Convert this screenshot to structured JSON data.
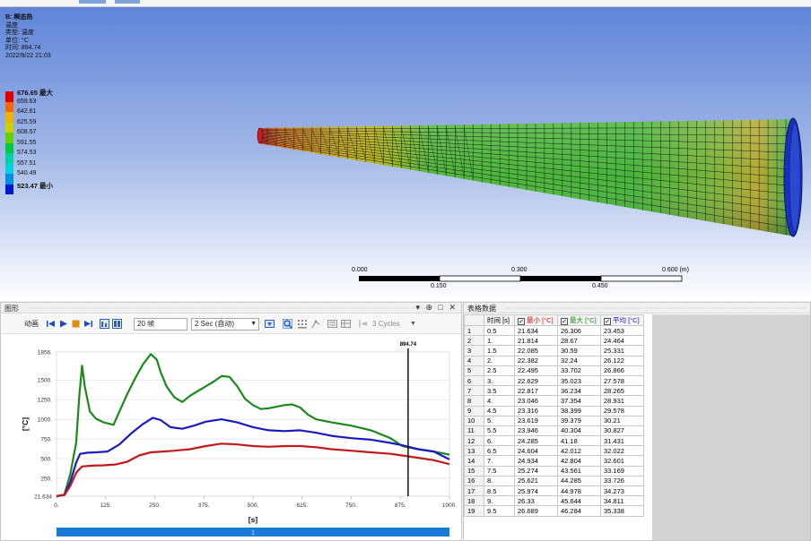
{
  "viewport": {
    "title": "B: 瞬态热",
    "line2": "温度",
    "line3": "类型: 温度",
    "line4": "单位: °C",
    "line5": "时间: 894.74",
    "line6": "2022/9/22 21:03",
    "legend": [
      {
        "label": "676.65 最大",
        "color": "#e00000",
        "bold": true
      },
      {
        "label": "659.63",
        "color": "#f06a00"
      },
      {
        "label": "642.61",
        "color": "#f0b400"
      },
      {
        "label": "625.59",
        "color": "#c8d200"
      },
      {
        "label": "608.57",
        "color": "#62d200"
      },
      {
        "label": "591.55",
        "color": "#00c840"
      },
      {
        "label": "574.53",
        "color": "#00d2a0"
      },
      {
        "label": "557.51",
        "color": "#00d2dc"
      },
      {
        "label": "540.49",
        "color": "#0090e0"
      },
      {
        "label": "523.47 最小",
        "color": "#0018d0",
        "bold": true
      }
    ],
    "scale": {
      "l0": "0.000",
      "l1": "0.150",
      "l2": "0.300",
      "l3": "0.450",
      "l4": "0.600 (m)"
    }
  },
  "graph_panel": {
    "title": "图形",
    "controls": "▾ ⊕ □ ✕",
    "anim_label": "动画",
    "frames": "20 帧",
    "speed": "2 Sec (自动)",
    "cycles": "3 Cycles"
  },
  "table_panel": {
    "title": "表格数据",
    "col_time": "时间 [s]",
    "col_min": "最小 [°C]",
    "col_max": "最大 [°C]",
    "col_avg": "平均 [°C]",
    "rows": [
      [
        "1",
        "0.5",
        "21.634",
        "26.306",
        "23.453"
      ],
      [
        "2",
        "1.",
        "21.814",
        "28.67",
        "24.464"
      ],
      [
        "3",
        "1.5",
        "22.085",
        "30.59",
        "25.331"
      ],
      [
        "4",
        "2.",
        "22.382",
        "32.24",
        "26.122"
      ],
      [
        "5",
        "2.5",
        "22.495",
        "33.702",
        "26.866"
      ],
      [
        "6",
        "3.",
        "22.629",
        "35.023",
        "27.578"
      ],
      [
        "7",
        "3.5",
        "22.817",
        "36.234",
        "28.265"
      ],
      [
        "8",
        "4.",
        "23.046",
        "37.354",
        "28.931"
      ],
      [
        "9",
        "4.5",
        "23.316",
        "38.399",
        "29.578"
      ],
      [
        "10",
        "5.",
        "23.619",
        "39.379",
        "30.21"
      ],
      [
        "11",
        "5.5",
        "23.946",
        "40.304",
        "30.827"
      ],
      [
        "12",
        "6.",
        "24.285",
        "41.18",
        "31.431"
      ],
      [
        "13",
        "6.5",
        "24.604",
        "42.012",
        "32.022"
      ],
      [
        "14",
        "7.",
        "24.934",
        "42.804",
        "32.601"
      ],
      [
        "15",
        "7.5",
        "25.274",
        "43.561",
        "33.169"
      ],
      [
        "16",
        "8.",
        "25.621",
        "44.285",
        "33.726"
      ],
      [
        "17",
        "8.5",
        "25.974",
        "44.978",
        "34.273"
      ],
      [
        "18",
        "9.",
        "26.33",
        "45.644",
        "34.811"
      ],
      [
        "19",
        "9.5",
        "26.689",
        "46.284",
        "35.338"
      ]
    ]
  },
  "chart_data": {
    "type": "line",
    "xlabel": "[s]",
    "ylabel": "[°C]",
    "xlim": [
      0,
      1000
    ],
    "ylim": [
      21.634,
      1856
    ],
    "xticks": [
      "0.",
      "125.",
      "250.",
      "375.",
      "500.",
      "625.",
      "750.",
      "875.",
      "1000."
    ],
    "yticks": [
      "21.634",
      "250.",
      "500.",
      "750.",
      "1000.",
      "1250.",
      "1500.",
      "1856."
    ],
    "marker_label": "894.74",
    "marker_x": 894.74,
    "progress_label": "1",
    "series": [
      {
        "color": "#1a8a1a",
        "points": [
          [
            0,
            22
          ],
          [
            20,
            45
          ],
          [
            35,
            300
          ],
          [
            50,
            700
          ],
          [
            58,
            1300
          ],
          [
            65,
            1680
          ],
          [
            72,
            1420
          ],
          [
            85,
            1100
          ],
          [
            100,
            1010
          ],
          [
            120,
            960
          ],
          [
            145,
            930
          ],
          [
            160,
            1100
          ],
          [
            180,
            1320
          ],
          [
            200,
            1520
          ],
          [
            220,
            1700
          ],
          [
            240,
            1830
          ],
          [
            255,
            1760
          ],
          [
            265,
            1600
          ],
          [
            280,
            1420
          ],
          [
            300,
            1280
          ],
          [
            320,
            1220
          ],
          [
            340,
            1300
          ],
          [
            360,
            1360
          ],
          [
            380,
            1420
          ],
          [
            400,
            1480
          ],
          [
            420,
            1550
          ],
          [
            440,
            1540
          ],
          [
            460,
            1420
          ],
          [
            480,
            1260
          ],
          [
            500,
            1180
          ],
          [
            520,
            1130
          ],
          [
            540,
            1140
          ],
          [
            560,
            1160
          ],
          [
            580,
            1180
          ],
          [
            600,
            1190
          ],
          [
            620,
            1150
          ],
          [
            640,
            1060
          ],
          [
            660,
            1000
          ],
          [
            700,
            960
          ],
          [
            750,
            920
          ],
          [
            800,
            860
          ],
          [
            850,
            760
          ],
          [
            880,
            660
          ],
          [
            920,
            620
          ],
          [
            960,
            590
          ],
          [
            1000,
            550
          ]
        ]
      },
      {
        "color": "#1a1ac0",
        "points": [
          [
            0,
            22
          ],
          [
            20,
            40
          ],
          [
            35,
            200
          ],
          [
            50,
            450
          ],
          [
            60,
            560
          ],
          [
            80,
            575
          ],
          [
            100,
            580
          ],
          [
            130,
            590
          ],
          [
            160,
            680
          ],
          [
            190,
            820
          ],
          [
            220,
            940
          ],
          [
            245,
            1020
          ],
          [
            265,
            990
          ],
          [
            290,
            900
          ],
          [
            320,
            880
          ],
          [
            350,
            920
          ],
          [
            380,
            970
          ],
          [
            420,
            1000
          ],
          [
            460,
            960
          ],
          [
            500,
            900
          ],
          [
            540,
            860
          ],
          [
            580,
            850
          ],
          [
            620,
            860
          ],
          [
            660,
            830
          ],
          [
            700,
            790
          ],
          [
            750,
            760
          ],
          [
            800,
            740
          ],
          [
            850,
            700
          ],
          [
            880,
            670
          ],
          [
            920,
            620
          ],
          [
            960,
            590
          ],
          [
            1000,
            490
          ]
        ]
      },
      {
        "color": "#c01a1a",
        "points": [
          [
            0,
            22
          ],
          [
            20,
            38
          ],
          [
            35,
            150
          ],
          [
            50,
            320
          ],
          [
            65,
            400
          ],
          [
            90,
            410
          ],
          [
            120,
            415
          ],
          [
            150,
            425
          ],
          [
            180,
            460
          ],
          [
            210,
            540
          ],
          [
            240,
            580
          ],
          [
            270,
            590
          ],
          [
            300,
            600
          ],
          [
            340,
            620
          ],
          [
            380,
            660
          ],
          [
            420,
            690
          ],
          [
            460,
            680
          ],
          [
            500,
            660
          ],
          [
            540,
            650
          ],
          [
            580,
            660
          ],
          [
            620,
            660
          ],
          [
            660,
            645
          ],
          [
            700,
            620
          ],
          [
            750,
            600
          ],
          [
            800,
            580
          ],
          [
            850,
            560
          ],
          [
            880,
            540
          ],
          [
            920,
            510
          ],
          [
            960,
            480
          ],
          [
            1000,
            430
          ]
        ]
      }
    ]
  }
}
